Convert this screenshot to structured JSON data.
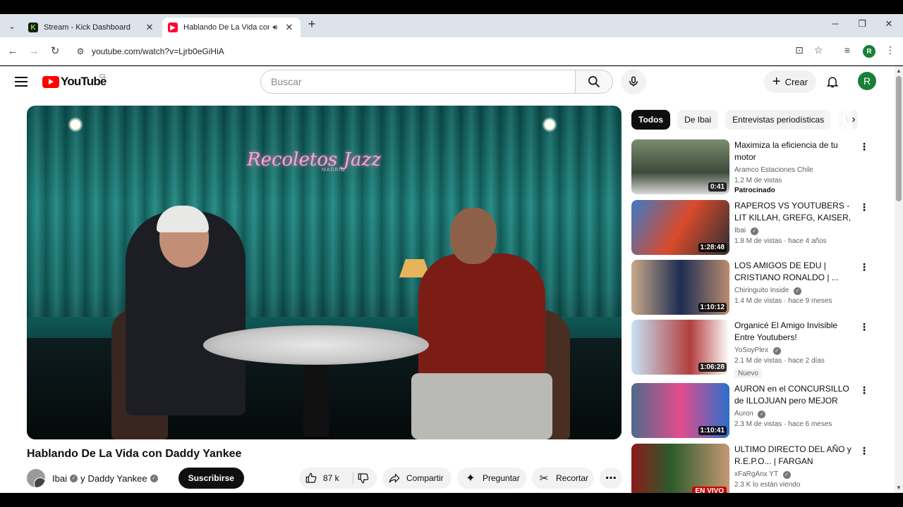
{
  "browser": {
    "tabs": [
      {
        "title": "Stream - Kick Dashboard",
        "favicon": "kick-icon",
        "active": false
      },
      {
        "title": "Hablando De La Vida con Daddy Yankee - YouTube",
        "favicon": "youtube-icon",
        "active": true,
        "audio": true
      }
    ],
    "url": "youtube.com/watch?v=Ljrb0eGiHiA",
    "profile_initial": "R"
  },
  "header": {
    "logo_text": "YouTube",
    "country_code": "CL",
    "search_placeholder": "Buscar",
    "create_label": "Crear",
    "avatar_initial": "R"
  },
  "video": {
    "neon_sign": "Recoletos Jazz",
    "neon_sub": "MADRID",
    "title": "Hablando De La Vida con Daddy Yankee",
    "channel_a": "Ibai",
    "channel_joiner": "y",
    "channel_b": "Daddy Yankee",
    "subscribe_label": "Suscribirse",
    "likes": "87 k",
    "share_label": "Compartir",
    "ask_label": "Preguntar",
    "clip_label": "Recortar"
  },
  "sidebar": {
    "chips": [
      "Todos",
      "De Ibai",
      "Entrevistas periodísticas",
      "V"
    ],
    "recommendations": [
      {
        "title": "Maximiza la eficiencia de tu motor",
        "channel": "Aramco Estaciones Chile",
        "verified": false,
        "meta": "1.2 M de vistas",
        "duration": "0:41",
        "extra": "Patrocinado",
        "extra_type": "sponsor"
      },
      {
        "title": "RAPEROS VS YOUTUBERS - LIT KILLAH, GREFG, KAISER, PAP...",
        "channel": "Ibai",
        "verified": true,
        "meta": "1.8 M de vistas · hace 4 años",
        "duration": "1:28:48",
        "extra": "",
        "extra_type": ""
      },
      {
        "title": "LOS AMIGOS DE EDU | CRISTIANO RONALDO | ...",
        "channel": "Chiringuito Inside",
        "verified": true,
        "meta": "1.4 M de vistas · hace 9 meses",
        "duration": "1:10:12",
        "extra": "",
        "extra_type": ""
      },
      {
        "title": "Organicé El Amigo Invisible Entre Youtubers!",
        "channel": "YoSoyPlex",
        "verified": true,
        "meta": "2.1 M de vistas · hace 2 días",
        "duration": "1:06:28",
        "extra": "Nuevo",
        "extra_type": "badge"
      },
      {
        "title": "AURON en el CONCURSILLO de ILLOJUAN pero MEJOR porqu...",
        "channel": "Auron",
        "verified": true,
        "meta": "2.3 M de vistas · hace 6 meses",
        "duration": "1:10:41",
        "extra": "",
        "extra_type": ""
      },
      {
        "title": "ULTIMO DIRECTO DEL AÑO y R.E.P.O... | FARGAN",
        "channel": "xFaRgAnx YT",
        "verified": true,
        "meta": "2.3 K lo están viendo",
        "duration": "EN VIVO",
        "extra": "",
        "extra_type": "live"
      }
    ]
  },
  "colors": {
    "brand": "#ff0000",
    "avatar": "#188038",
    "chip_active": "#0f0f0f"
  }
}
